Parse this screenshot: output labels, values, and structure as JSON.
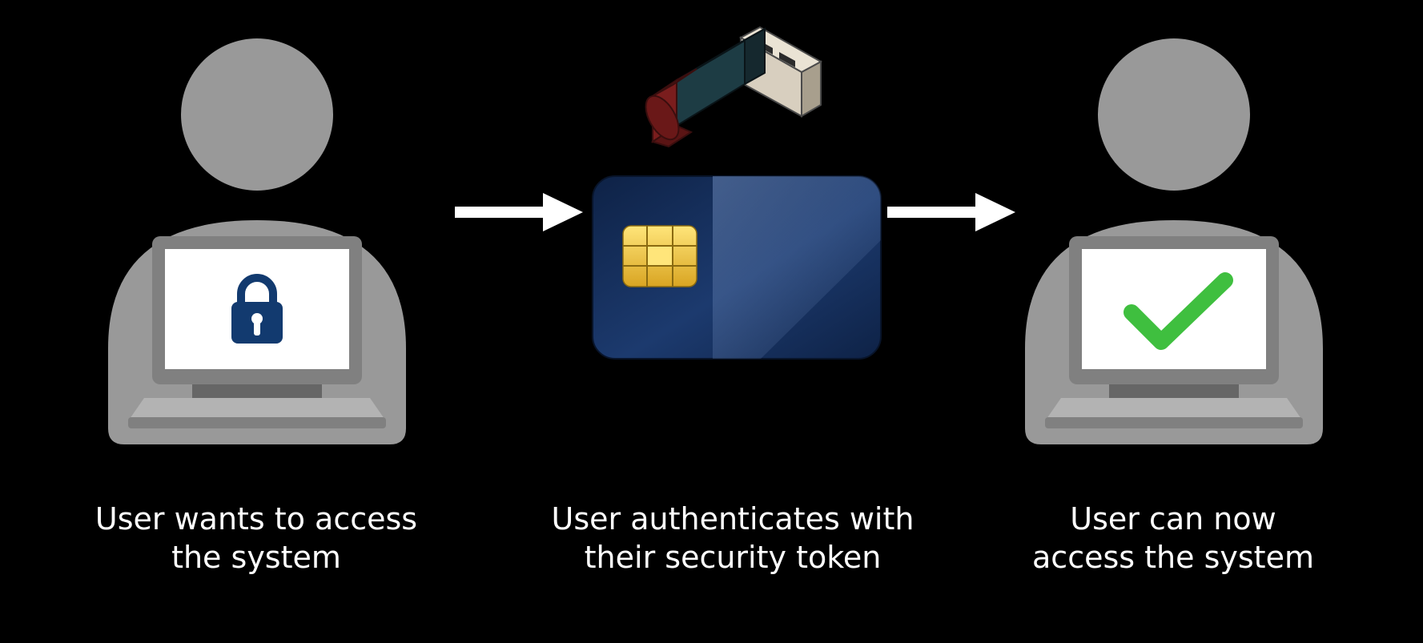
{
  "diagram": {
    "steps": [
      {
        "id": "request",
        "caption": "User wants to access\nthe system",
        "icon": "user-laptop-locked"
      },
      {
        "id": "authenticate",
        "caption": "User authenticates with\ntheir security token",
        "icon": "security-tokens"
      },
      {
        "id": "granted",
        "caption": "User can now\naccess the system",
        "icon": "user-laptop-granted"
      }
    ],
    "arrows": [
      "arrow-1",
      "arrow-2"
    ]
  },
  "colors": {
    "user_gray": "#999999",
    "laptop_gray": "#808080",
    "laptop_light": "#b3b3b3",
    "laptop_dark": "#666666",
    "screen_white": "#ffffff",
    "lock_blue": "#123a6f",
    "check_green": "#3fbf3f",
    "arrow_white": "#ffffff",
    "card_navy_dark": "#0e2246",
    "card_navy_mid": "#1c3a6e",
    "card_navy_light": "#3a5d9e",
    "chip_gold": "#f5c93a",
    "chip_gold_dark": "#b98f18",
    "usb_body_dark": "#1d3c44",
    "usb_cap_red": "#7a1d1d",
    "usb_metal": "#d8cfbf",
    "usb_metal_dark": "#a89f8d"
  }
}
